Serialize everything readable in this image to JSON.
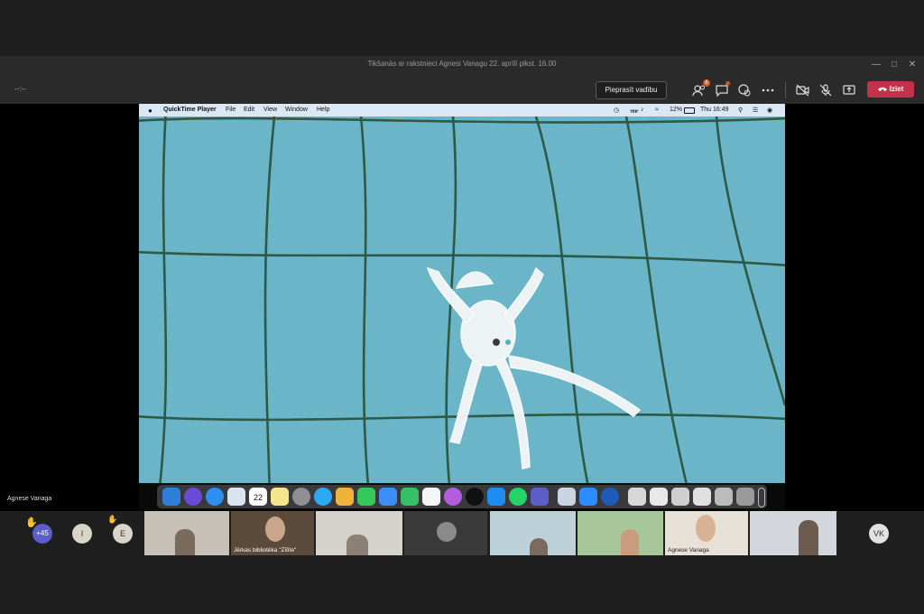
{
  "window": {
    "title": "Tikšanās ar rakstnieci Agnesi Vanagu 22. aprīlī plkst. 16.00"
  },
  "toolbar": {
    "timer": "--:--",
    "request_control_label": "Pieprasīt vadību",
    "people_badge": "6",
    "leave_label": "Iziet"
  },
  "shared_screen": {
    "app_menu": [
      "QuickTime Player",
      "File",
      "Edit",
      "View",
      "Window",
      "Help"
    ],
    "battery": "12%",
    "clock": "Thu 16:49",
    "calendar_day": "22"
  },
  "presenter": {
    "name": "Agnese Vanaga"
  },
  "participants": {
    "overflow_count": "+45",
    "avatar_i": "I",
    "avatar_e": "E",
    "tile_library_label": "Jērkas bibliotēka \"Zīlīte\"",
    "tile_agnese_label": "Agnese Vanaga",
    "avatar_vk": "VK"
  },
  "colors": {
    "leave": "#c4314b",
    "badge": "#c95d25",
    "video_bg": "#6bb5c8"
  }
}
